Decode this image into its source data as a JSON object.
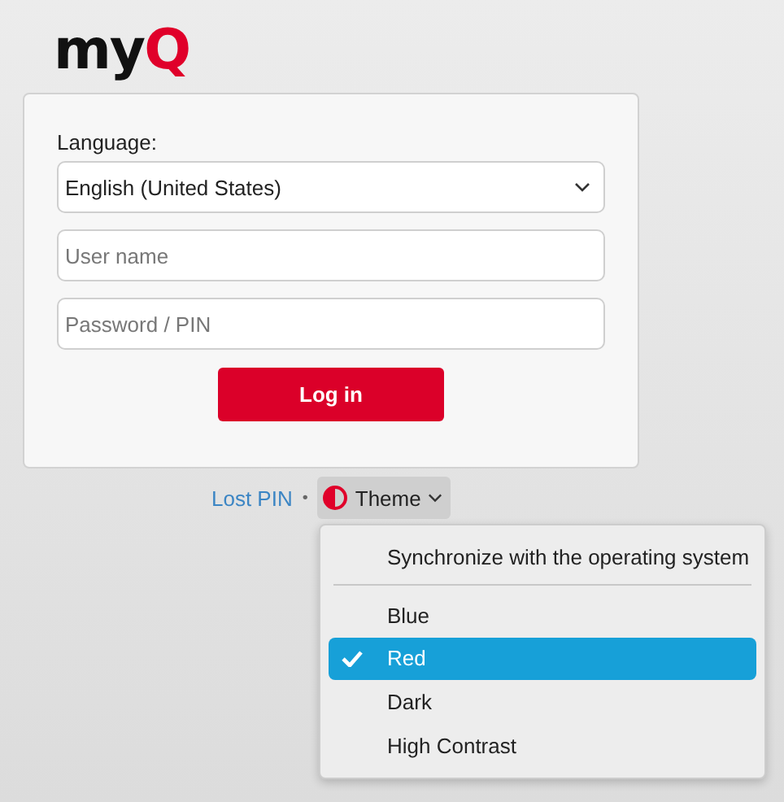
{
  "logo": {
    "text": "my",
    "accent": "Q"
  },
  "login": {
    "language_label": "Language:",
    "language_value": "English (United States)",
    "username_placeholder": "User name",
    "password_placeholder": "Password / PIN",
    "submit": "Log in"
  },
  "footer": {
    "lost_pin": "Lost PIN",
    "separator": "•",
    "theme_button": "Theme",
    "expanded": true
  },
  "theme_menu": {
    "sync_option": {
      "label": "Synchronize with the operating system",
      "selected": false
    },
    "themes": [
      {
        "label": "Blue",
        "selected": false
      },
      {
        "label": "Red",
        "selected": true
      },
      {
        "label": "Dark",
        "selected": false
      },
      {
        "label": "High Contrast",
        "selected": false
      }
    ]
  }
}
